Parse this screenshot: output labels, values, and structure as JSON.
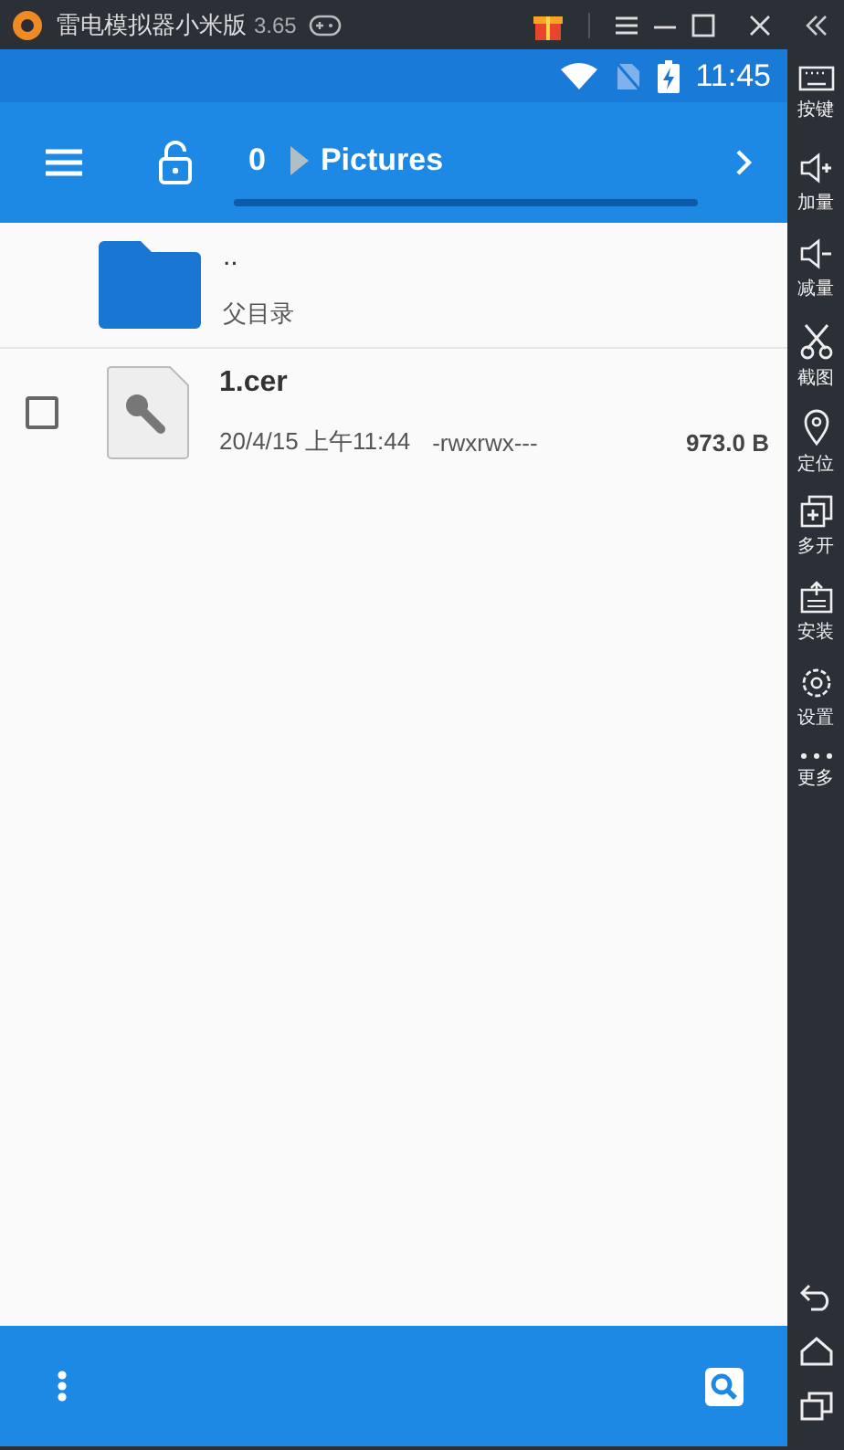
{
  "window": {
    "title": "雷电模拟器小米版",
    "version": "3.65"
  },
  "status_bar": {
    "time": "11:45"
  },
  "toolbar": {
    "count": "0",
    "path": "Pictures"
  },
  "files": [
    {
      "kind": "parent",
      "name": "..",
      "detail": "父目录"
    },
    {
      "kind": "file",
      "name": "1.cer",
      "date": "20/4/15 上午11:44",
      "permissions": "-rwxrwx---",
      "size": "973.0 B",
      "checked": false
    }
  ],
  "sidebar": {
    "items": [
      {
        "label": "按键"
      },
      {
        "label": "加量"
      },
      {
        "label": "减量"
      },
      {
        "label": "截图"
      },
      {
        "label": "定位"
      },
      {
        "label": "多开"
      },
      {
        "label": "安装"
      },
      {
        "label": "设置"
      },
      {
        "label": "更多"
      }
    ]
  }
}
